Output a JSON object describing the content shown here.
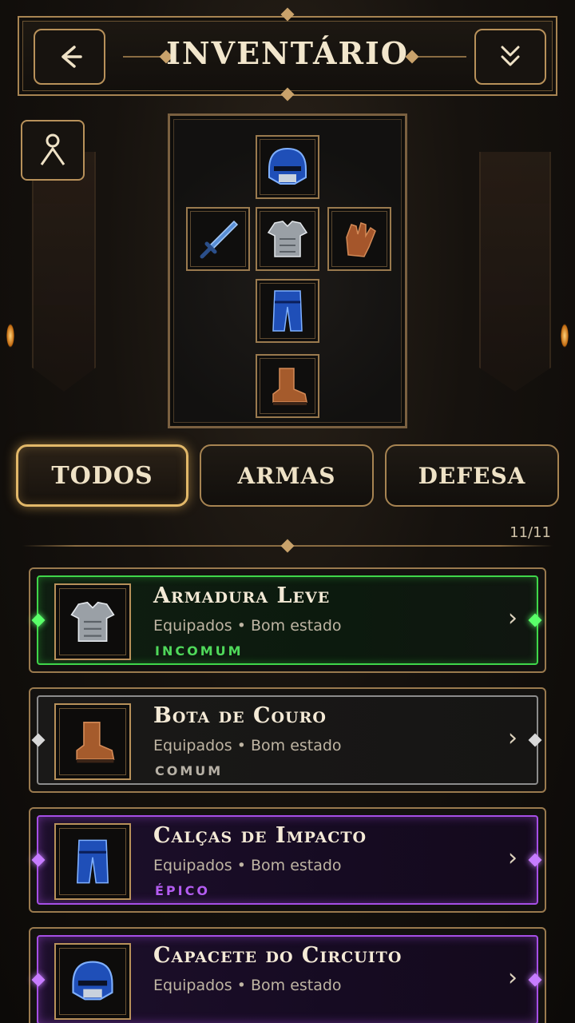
{
  "header": {
    "title": "INVENTÁRIO",
    "back_icon": "arrow-left-icon",
    "collapse_icon": "double-chevron-down-icon"
  },
  "profile_icon": "character-icon",
  "equipment": {
    "head": "helmet-icon",
    "weapon": "dagger-icon",
    "chest": "chest-armor-icon",
    "hands": "glove-icon",
    "legs": "pants-icon",
    "feet": "boot-icon"
  },
  "tabs": [
    {
      "label": "TODOS",
      "active": true
    },
    {
      "label": "ARMAS",
      "active": false
    },
    {
      "label": "DEFESA",
      "active": false
    }
  ],
  "item_count": "11/11",
  "items": [
    {
      "name": "Armadura Leve",
      "status": "Equipados",
      "condition": "Bom estado",
      "rarity": "INCOMUM",
      "icon": "chest-armor-icon"
    },
    {
      "name": "Bota de Couro",
      "status": "Equipados",
      "condition": "Bom estado",
      "rarity": "COMUM",
      "icon": "boot-icon"
    },
    {
      "name": "Calças de Impacto",
      "status": "Equipados",
      "condition": "Bom estado",
      "rarity": "ÉPICO",
      "icon": "pants-icon"
    },
    {
      "name": "Capacete do Circuito",
      "status": "Equipados",
      "condition": "Bom estado",
      "rarity": "",
      "icon": "helmet-icon"
    }
  ],
  "colors": {
    "gold": "#b8915a",
    "uncommon": "#3fd64a",
    "common": "#8c8c8c",
    "epic": "#a64fe6"
  }
}
